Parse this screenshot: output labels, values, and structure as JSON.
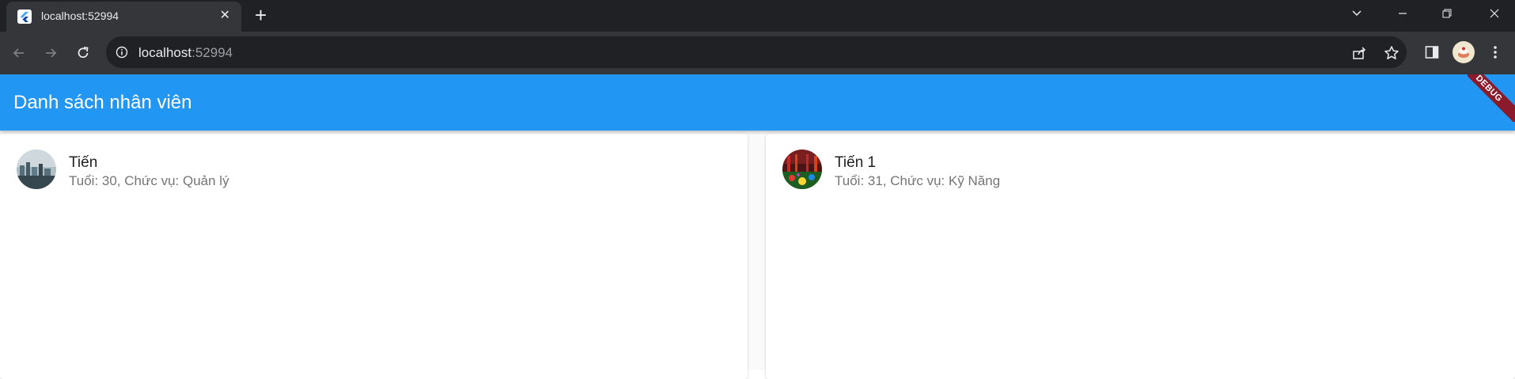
{
  "browser": {
    "tab_title": "localhost:52994",
    "close_symbol": "✕",
    "new_tab_symbol": "+",
    "url_host": "localhost",
    "url_port": ":52994",
    "icons": [
      "flutter-favicon",
      "back-icon",
      "forward-icon",
      "reload-icon",
      "info-icon",
      "share-icon",
      "star-icon",
      "sidepanel-icon",
      "profile-avatar",
      "menu-icon",
      "chevron-down-icon",
      "minimize-icon",
      "restore-icon",
      "window-close-icon"
    ]
  },
  "app": {
    "title": "Danh sách nhân viên",
    "debug_label": "DEBUG",
    "appbar_color": "#2196f3"
  },
  "employees": [
    {
      "name": "Tiến",
      "details": "Tuổi: 30, Chức vụ: Quản lý"
    },
    {
      "name": "Tiến 1",
      "details": "Tuổi: 31, Chức vụ: Kỹ Năng"
    }
  ]
}
